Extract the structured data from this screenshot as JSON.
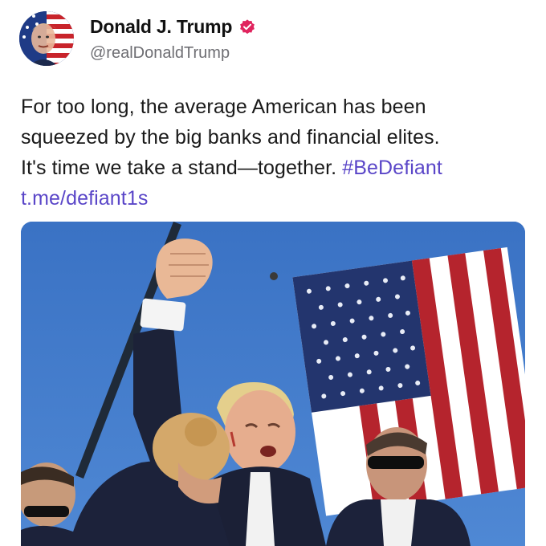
{
  "post": {
    "author": {
      "display_name": "Donald J. Trump",
      "handle": "@realDonaldTrump",
      "verified": true,
      "avatar_icon": "flag-portrait-avatar",
      "badge_icon": "verified-badge-icon",
      "badge_color": "#e0245e"
    },
    "text": {
      "line1": "For too long, the average American has been",
      "line2": "squeezed by the big banks and financial elites.",
      "line3": "It's time we take a stand—together.",
      "hashtag": "#BeDefiant",
      "link": "t.me/defiant1s"
    },
    "colors": {
      "link": "#5a46c8",
      "handle": "#6e6e73",
      "sky": "#3f77c8"
    }
  }
}
